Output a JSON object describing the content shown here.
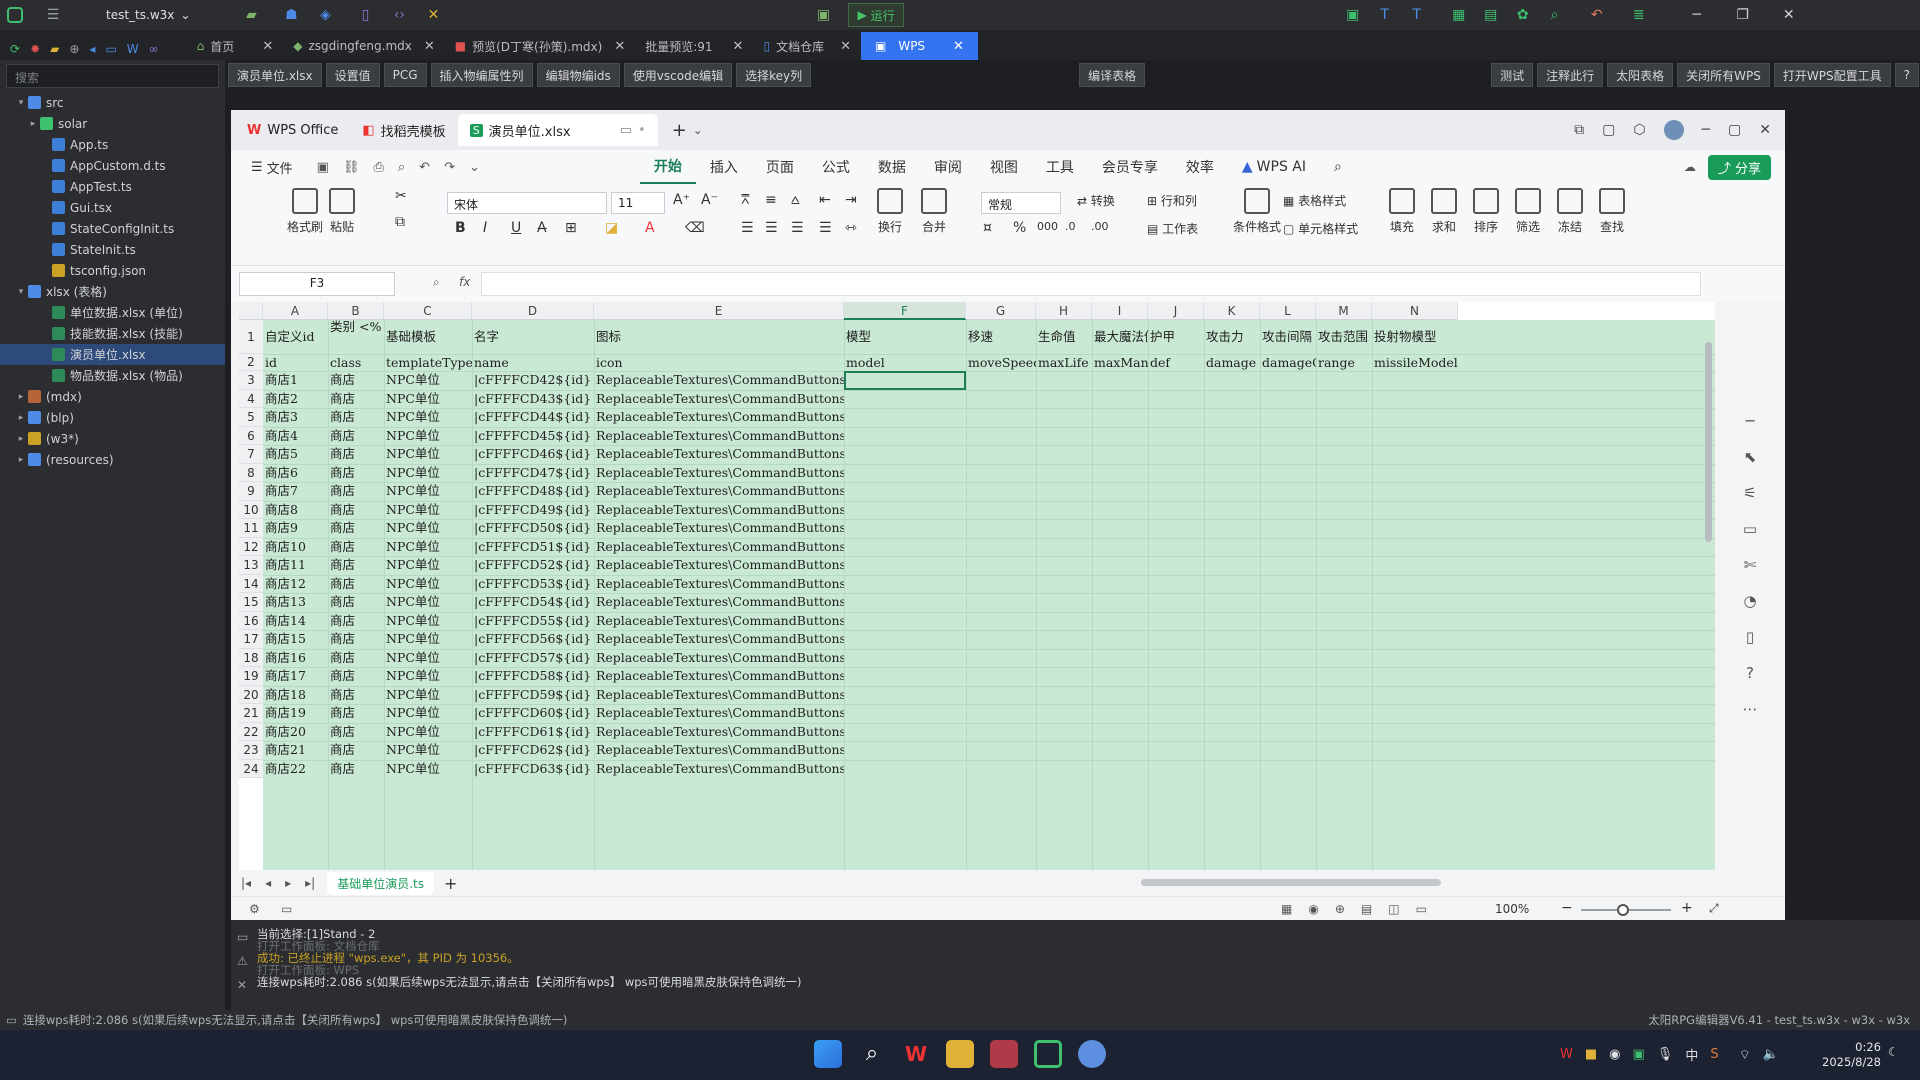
{
  "ide": {
    "project": "test_ts.w3x",
    "run_label": "运行",
    "tabs": [
      "首页",
      "zsgdingfeng.mdx",
      "预览(D丁寒(孙策).mdx)",
      "批量预览:91",
      "文档仓库",
      "WPS"
    ],
    "plugin_buttons": [
      "演员单位.xlsx",
      "设置值",
      "PCG",
      "插入物编属性列",
      "编辑物编ids",
      "使用vscode编辑",
      "选择key列"
    ],
    "plugin_center": "编译表格",
    "plugin_right": [
      "测试",
      "注释此行",
      "太阳表格",
      "关闭所有WPS",
      "打开WPS配置工具"
    ],
    "search_placeholder": "搜索",
    "tree": [
      {
        "label": "src",
        "level": 0,
        "arrow": "▾",
        "icon": "folder"
      },
      {
        "label": "solar",
        "level": 1,
        "arrow": "▸",
        "icon": "solar"
      },
      {
        "label": "App.ts",
        "level": 2,
        "arrow": "",
        "icon": "ts"
      },
      {
        "label": "AppCustom.d.ts",
        "level": 2,
        "arrow": "",
        "icon": "ts"
      },
      {
        "label": "AppTest.ts",
        "level": 2,
        "arrow": "",
        "icon": "ts"
      },
      {
        "label": "Gui.tsx",
        "level": 2,
        "arrow": "",
        "icon": "ts"
      },
      {
        "label": "StateConfigInit.ts",
        "level": 2,
        "arrow": "",
        "icon": "ts"
      },
      {
        "label": "StateInit.ts",
        "level": 2,
        "arrow": "",
        "icon": "ts"
      },
      {
        "label": "tsconfig.json",
        "level": 2,
        "arrow": "",
        "icon": "json"
      },
      {
        "label": "xlsx (表格)",
        "level": 0,
        "arrow": "▾",
        "icon": "folder"
      },
      {
        "label": "单位数据.xlsx (单位)",
        "level": 2,
        "arrow": "",
        "icon": "xlsx"
      },
      {
        "label": "技能数据.xlsx (技能)",
        "level": 2,
        "arrow": "",
        "icon": "xlsx"
      },
      {
        "label": "演员单位.xlsx",
        "level": 2,
        "arrow": "",
        "icon": "xlsx",
        "selected": true
      },
      {
        "label": "物品数据.xlsx (物品)",
        "level": 2,
        "arrow": "",
        "icon": "xlsx"
      },
      {
        "label": "(mdx)",
        "level": 0,
        "arrow": "▸",
        "icon": "mdx"
      },
      {
        "label": "(blp)",
        "level": 0,
        "arrow": "▸",
        "icon": "blp"
      },
      {
        "label": "(w3*)",
        "level": 0,
        "arrow": "▸",
        "icon": "w3"
      },
      {
        "label": "(resources)",
        "level": 0,
        "arrow": "▸",
        "icon": "folder"
      }
    ],
    "console": [
      {
        "text": "当前选择:[1]Stand - 2",
        "color": "#d8dadd"
      },
      {
        "text": "打开工作面板: 文档仓库",
        "color": "#6b6e73"
      },
      {
        "text": "成功: 已终止进程 \"wps.exe\"，其 PID 为 10356。",
        "color": "#c9a227"
      },
      {
        "text": "打开工作面板: WPS",
        "color": "#6b6e73"
      },
      {
        "text": "连接wps耗时:2.086 s(如果后续wps无法显示,请点击【关闭所有wps】 wps可使用暗黑皮肤保持色调统一)",
        "color": "#d8dadd"
      }
    ],
    "status_left": "连接wps耗时:2.086 s(如果后续wps无法显示,请点击【关闭所有wps】 wps可使用暗黑皮肤保持色调统一)",
    "status_right": "太阳RPG编辑器V6.41 - test_ts.w3x - w3x - w3x"
  },
  "wps": {
    "tabs": [
      "WPS Office",
      "找稻壳模板",
      "演员单位.xlsx"
    ],
    "ribbon_tabs": [
      "文件",
      "开始",
      "插入",
      "页面",
      "公式",
      "数据",
      "审阅",
      "视图",
      "工具",
      "会员专享",
      "效率",
      "WPS AI"
    ],
    "active_ribbon": "开始",
    "share": "分享",
    "font": "宋体",
    "size": "11",
    "numfmt": "常规",
    "big_buttons": [
      "格式刷",
      "粘贴",
      "换行",
      "合并",
      "填充",
      "求和",
      "排序",
      "筛选",
      "冻结",
      "查找",
      "条件格式"
    ],
    "small_labels": [
      "转换",
      "行和列",
      "工作表",
      "表格样式",
      "单元格样式"
    ],
    "cell_ref": "F3",
    "fx": "fx",
    "sheet_tab": "基础单位演员.ts",
    "zoom": "100%"
  },
  "sheet": {
    "columns": [
      "A",
      "B",
      "C",
      "D",
      "E",
      "F",
      "G",
      "H",
      "I",
      "J",
      "K",
      "L",
      "M",
      "N"
    ],
    "row1": [
      "自定义id",
      "类别 <%",
      "基础模板",
      "名字",
      "图标",
      "模型",
      "移速",
      "生命值",
      "最大魔法值",
      "护甲",
      "攻击力",
      "攻击间隔",
      "攻击范围",
      "投射物模型"
    ],
    "row2": [
      "id",
      "class",
      "templateType",
      "name",
      "icon",
      "model",
      "moveSpeed",
      "maxLife",
      "maxMana",
      "def",
      "damage",
      "damageCd",
      "range",
      "missileModel"
    ],
    "rows": [
      [
        "3",
        "商店1",
        "商店",
        "NPC单位",
        "|cFFFFCD42${id}"
      ],
      [
        "4",
        "商店2",
        "商店",
        "NPC单位",
        "|cFFFFCD43${id}"
      ],
      [
        "5",
        "商店3",
        "商店",
        "NPC单位",
        "|cFFFFCD44${id}"
      ],
      [
        "6",
        "商店4",
        "商店",
        "NPC单位",
        "|cFFFFCD45${id}"
      ],
      [
        "7",
        "商店5",
        "商店",
        "NPC单位",
        "|cFFFFCD46${id}"
      ],
      [
        "8",
        "商店6",
        "商店",
        "NPC单位",
        "|cFFFFCD47${id}"
      ],
      [
        "9",
        "商店7",
        "商店",
        "NPC单位",
        "|cFFFFCD48${id}"
      ],
      [
        "10",
        "商店8",
        "商店",
        "NPC单位",
        "|cFFFFCD49${id}"
      ],
      [
        "11",
        "商店9",
        "商店",
        "NPC单位",
        "|cFFFFCD50${id}"
      ],
      [
        "12",
        "商店10",
        "商店",
        "NPC单位",
        "|cFFFFCD51${id}"
      ],
      [
        "13",
        "商店11",
        "商店",
        "NPC单位",
        "|cFFFFCD52${id}"
      ],
      [
        "14",
        "商店12",
        "商店",
        "NPC单位",
        "|cFFFFCD53${id}"
      ],
      [
        "15",
        "商店13",
        "商店",
        "NPC单位",
        "|cFFFFCD54${id}"
      ],
      [
        "16",
        "商店14",
        "商店",
        "NPC单位",
        "|cFFFFCD55${id}"
      ],
      [
        "17",
        "商店15",
        "商店",
        "NPC单位",
        "|cFFFFCD56${id}"
      ],
      [
        "18",
        "商店16",
        "商店",
        "NPC单位",
        "|cFFFFCD57${id}"
      ],
      [
        "19",
        "商店17",
        "商店",
        "NPC单位",
        "|cFFFFCD58${id}"
      ],
      [
        "20",
        "商店18",
        "商店",
        "NPC单位",
        "|cFFFFCD59${id}"
      ],
      [
        "21",
        "商店19",
        "商店",
        "NPC单位",
        "|cFFFFCD60${id}"
      ],
      [
        "22",
        "商店20",
        "商店",
        "NPC单位",
        "|cFFFFCD61${id}"
      ],
      [
        "23",
        "商店21",
        "商店",
        "NPC单位",
        "|cFFFFCD62${id}"
      ],
      [
        "24",
        "商店22",
        "商店",
        "NPC单位",
        "|cFFFFCD63${id}"
      ]
    ],
    "icon_value": "ReplaceableTextures\\CommandButtons\\BTNFr"
  },
  "taskbar": {
    "time": "0:26",
    "date": "2025/8/28",
    "ime": "中"
  }
}
